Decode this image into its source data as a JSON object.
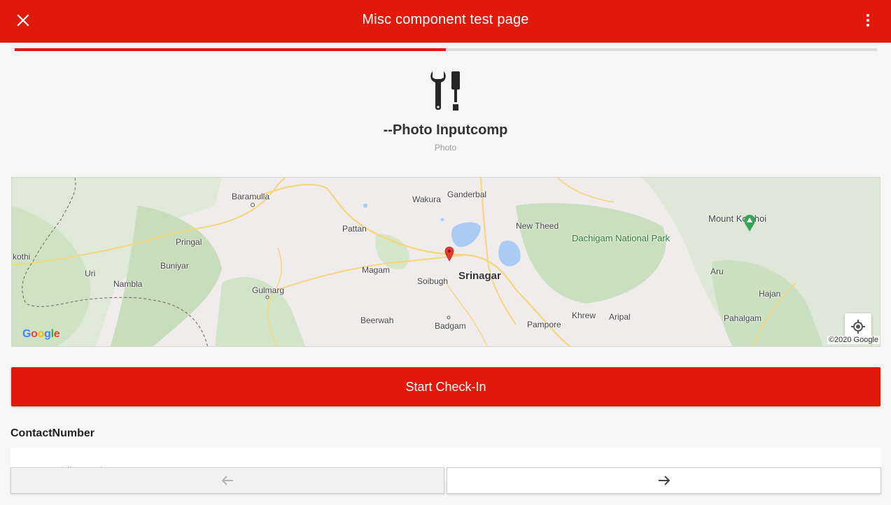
{
  "appbar": {
    "title": "Misc component test page",
    "close_icon": "close-icon",
    "more_icon": "more-vert-icon",
    "accent_color": "#e0190b"
  },
  "progress": {
    "value_percent": 50
  },
  "component": {
    "icon": "tools-icon",
    "title": "--Photo Inputcomp",
    "subtitle": "Photo"
  },
  "map": {
    "places": {
      "baramulla": "Baramulla",
      "wakura": "Wakura",
      "ganderbal": "Ganderbal",
      "pattan": "Pattan",
      "new_theed": "New Theed",
      "dachigam": "Dachigam National Park",
      "mount_kolahoi": "Mount Kolahoi",
      "kothi": "kothi",
      "pringal": "Pringal",
      "buniyar": "Buniyar",
      "uri": "Uri",
      "nambla": "Nambla",
      "magam": "Magam",
      "soibugh": "Soibugh",
      "srinagar": "Srinagar",
      "gulmarg": "Gulmarg",
      "aru": "Aru",
      "hajan": "Hajan",
      "beerwah": "Beerwah",
      "badgam": "Badgam",
      "pampore": "Pampore",
      "khrew": "Khrew",
      "aripal": "Aripal",
      "pahalgam": "Pahalgam"
    },
    "logo": "Google",
    "copyright": "©2020 Google",
    "locate_icon": "my-location-icon",
    "pin_icon": "map-pin-icon"
  },
  "checkin_button": "Start Check-In",
  "contact": {
    "label": "ContactNumber",
    "placeholder": "EnterMobileNumber",
    "value": ""
  },
  "nav": {
    "prev_icon": "arrow-left-icon",
    "next_icon": "arrow-right-icon"
  }
}
